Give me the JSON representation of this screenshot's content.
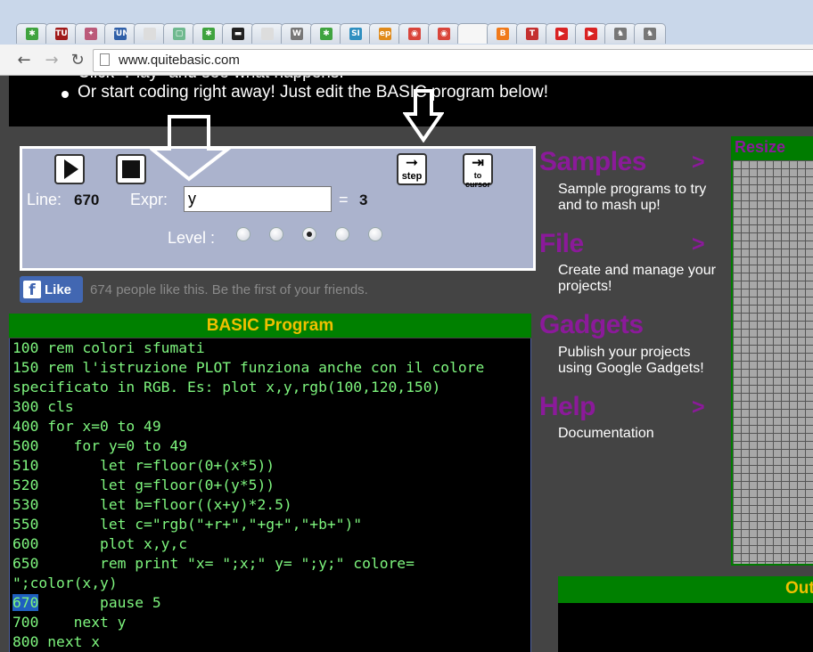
{
  "browser": {
    "tabs": [
      {
        "icon": "evernote-tab-icon",
        "glyph": "✱",
        "color": "#3fa33f"
      },
      {
        "icon": "tu-tab-icon",
        "glyph": "TU",
        "color": "#a01a1a"
      },
      {
        "icon": "fish-tab-icon",
        "glyph": "✦",
        "color": "#bb5a7a"
      },
      {
        "icon": "tum-tab-icon",
        "glyph": "TUM",
        "color": "#2f5fa8"
      },
      {
        "icon": "doc-tab-icon",
        "glyph": "",
        "color": "#dddddd"
      },
      {
        "icon": "green-square-tab-icon",
        "glyph": "▢",
        "color": "#6fb98f"
      },
      {
        "icon": "evernote-tab-icon",
        "glyph": "✱",
        "color": "#3fa33f"
      },
      {
        "icon": "terminal-tab-icon",
        "glyph": "▬",
        "color": "#222222"
      },
      {
        "icon": "doc-tab-icon",
        "glyph": "",
        "color": "#dddddd"
      },
      {
        "icon": "wikipedia-tab-icon",
        "glyph": "W",
        "color": "#777777"
      },
      {
        "icon": "evernote-tab-icon",
        "glyph": "✱",
        "color": "#3fa33f"
      },
      {
        "icon": "si-tab-icon",
        "glyph": "SI",
        "color": "#2f8fc0"
      },
      {
        "icon": "ep-tab-icon",
        "glyph": "ep",
        "color": "#e08a1a"
      },
      {
        "icon": "chrome-tab-icon",
        "glyph": "◉",
        "color": "#d9453b"
      },
      {
        "icon": "chrome-tab-icon",
        "glyph": "◉",
        "color": "#d9453b"
      },
      {
        "icon": "active-tab-icon",
        "glyph": "",
        "color": "#f6f6f6"
      },
      {
        "icon": "blogger-tab-icon",
        "glyph": "B",
        "color": "#f07a1a"
      },
      {
        "icon": "t-tab-icon",
        "glyph": "T",
        "color": "#c43030"
      },
      {
        "icon": "youtube-tab-icon",
        "glyph": "▶",
        "color": "#d92323"
      },
      {
        "icon": "youtube-tab-icon",
        "glyph": "▶",
        "color": "#d92323"
      },
      {
        "icon": "cow-tab-icon",
        "glyph": "♞",
        "color": "#777777"
      },
      {
        "icon": "cow-tab-icon",
        "glyph": "♞",
        "color": "#777777"
      }
    ],
    "url": "www.quitebasic.com"
  },
  "intro": {
    "cut_line": "Click \"Play\" and see what happens.",
    "line2": "Or start coding right away! Just edit the BASIC program below!"
  },
  "controls": {
    "line_label": "Line:",
    "line_value": "670",
    "expr_label": "Expr:",
    "expr_value": "y",
    "equals": "=",
    "expr_result": "3",
    "level_label": "Level :",
    "step_label": "step",
    "to_cursor_label": "to cursor",
    "selected_level": 3
  },
  "like": {
    "button": "Like",
    "text": "674 people like this. Be the first of your friends."
  },
  "program": {
    "header": "BASIC Program",
    "lines": [
      "100 rem colori sfumati",
      "150 rem l'istruzione PLOT funziona anche con il colore",
      "specificato in RGB. Es: plot x,y,rgb(100,120,150)",
      "300 cls",
      "400 for x=0 to 49",
      "500    for y=0 to 49",
      "510       let r=floor(0+(x*5))",
      "520       let g=floor(0+(y*5))",
      "530       let b=floor((x+y)*2.5)",
      "550       let c=\"rgb(\"+r+\",\"+g+\",\"+b+\")\"",
      "600       plot x,y,c",
      "650       rem print \"x= \";x;\" y= \";y;\" colore=",
      "\";color(x,y)",
      "670       pause 5",
      "700    next y",
      "800 next x"
    ],
    "highlight_line": 13
  },
  "side": {
    "samples": {
      "title": "Samples",
      "arrow": ">",
      "desc": "Sample programs to try and to mash up!"
    },
    "file": {
      "title": "File",
      "arrow": ">",
      "desc": "Create and manage your projects!"
    },
    "gadgets": {
      "title": "Gadgets",
      "arrow": "",
      "desc": "Publish your projects using Google Gadgets!"
    },
    "help": {
      "title": "Help",
      "arrow": ">",
      "desc": "Documentation"
    }
  },
  "grid": {
    "title": "Resize"
  },
  "output": {
    "title": "Out"
  }
}
